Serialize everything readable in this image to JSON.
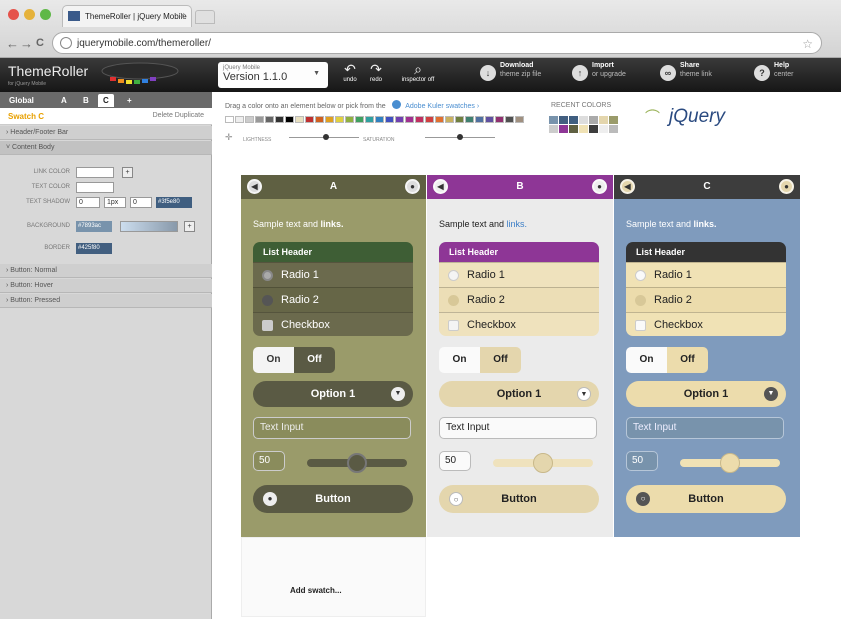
{
  "browser": {
    "tab_title": "ThemeRoller | jQuery Mobile",
    "tab_close": "×",
    "url": "jquerymobile.com/themeroller/",
    "back": "←",
    "forward": "→",
    "reload": "C",
    "star": "☆"
  },
  "toolbar": {
    "logo": "ThemeRoller",
    "logo_sub": "for jQuery Mobile",
    "version_small": "jQuery Mobile",
    "version": "Version 1.1.0",
    "undo": "undo",
    "redo": "redo",
    "inspector": "inspector off",
    "download": "Download",
    "download_sub": "theme zip file",
    "import": "Import",
    "import_sub": "or upgrade",
    "share": "Share",
    "share_sub": "theme link",
    "help": "Help",
    "help_sub": "center"
  },
  "sidebar": {
    "tabs": [
      "Global",
      "A",
      "B",
      "C",
      "+"
    ],
    "swatch_label": "Swatch C",
    "swatch_actions": "Delete  Duplicate",
    "sections": {
      "header_footer": "› Header/Footer Bar",
      "content_body": "˅ Content Body",
      "button_normal": "› Button: Normal",
      "button_hover": "› Button: Hover",
      "button_pressed": "› Button: Pressed"
    },
    "fields": {
      "link_color_label": "LINK COLOR",
      "text_color_label": "TEXT COLOR",
      "text_shadow_label": "TEXT SHADOW",
      "shadow_x": "0",
      "shadow_y": "1px",
      "shadow_blur": "0",
      "shadow_color": "#3f5e80",
      "background_label": "BACKGROUND",
      "background_value": "#7893ac",
      "border_label": "BORDER",
      "border_value": "#425f80"
    }
  },
  "main": {
    "instructions": "Drag a color onto an element below or pick from the",
    "adobe_link": "Adobe Kuler swatches ›",
    "recent_colors": "RECENT COLORS",
    "lightness": "LIGHTNESS",
    "saturation": "SATURATION",
    "jquery_logo": "jQuery",
    "add_swatch": "Add swatch..."
  },
  "swatches": [
    {
      "name": "A",
      "sample_text": "Sample text and ",
      "link_text": "links.",
      "list_header": "List Header",
      "radio1": "Radio 1",
      "radio2": "Radio 2",
      "checkbox": "Checkbox",
      "on": "On",
      "off": "Off",
      "select_option": "Option 1",
      "text_input": "Text Input",
      "number_value": "50",
      "slider_fraction": 0.5,
      "button_label": "Button"
    },
    {
      "name": "B",
      "sample_text": "Sample text and ",
      "link_text": "links.",
      "list_header": "List Header",
      "radio1": "Radio 1",
      "radio2": "Radio 2",
      "checkbox": "Checkbox",
      "on": "On",
      "off": "Off",
      "select_option": "Option 1",
      "text_input": "Text Input",
      "number_value": "50",
      "slider_fraction": 0.5,
      "button_label": "Button"
    },
    {
      "name": "C",
      "sample_text": "Sample text and ",
      "link_text": "links.",
      "list_header": "List Header",
      "radio1": "Radio 1",
      "radio2": "Radio 2",
      "checkbox": "Checkbox",
      "on": "On",
      "off": "Off",
      "select_option": "Option 1",
      "text_input": "Text Input",
      "number_value": "50",
      "slider_fraction": 0.5,
      "button_label": "Button"
    }
  ],
  "colors": {
    "swatch_a_bg": "#9a9b6a",
    "swatch_a_header": "#5f6042",
    "swatch_b_header": "#8e3696",
    "swatch_c_bg": "#7f9bbd",
    "swatch_c_header": "#3d3d3d",
    "accent": "#e8a000"
  }
}
